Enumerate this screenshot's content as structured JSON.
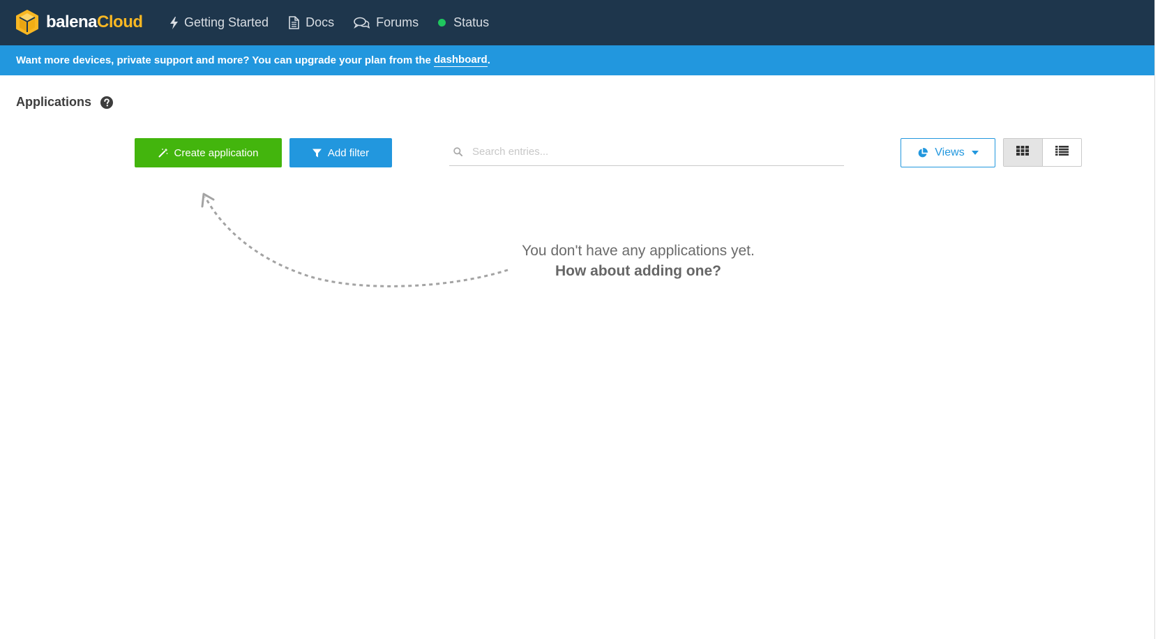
{
  "brand": {
    "part1": "balena",
    "part2": "Cloud"
  },
  "nav": {
    "getting_started": "Getting Started",
    "docs": "Docs",
    "forums": "Forums",
    "status": "Status"
  },
  "banner": {
    "text": "Want more devices, private support and more? You can upgrade your plan from the ",
    "link": "dashboard",
    "suffix": "."
  },
  "page": {
    "title": "Applications"
  },
  "toolbar": {
    "create_label": "Create application",
    "filter_label": "Add filter",
    "search_placeholder": "Search entries...",
    "views_label": "Views"
  },
  "empty_state": {
    "line1": "You don't have any applications yet.",
    "line2": "How about adding one?"
  },
  "colors": {
    "nav_bg": "#1e364c",
    "banner_bg": "#2297de",
    "brand_accent": "#f8b723",
    "create_green": "#43b50d",
    "status_green": "#1fc65e"
  },
  "icons": {
    "logo": "balena-cube-logo",
    "getting_started": "lightning-bolt-icon",
    "docs": "document-icon",
    "forums": "chat-bubbles-icon",
    "status": "status-dot",
    "help": "question-circle-icon",
    "create": "magic-wand-icon",
    "filter": "funnel-icon",
    "search": "search-icon",
    "views": "pie-chart-icon",
    "grid": "grid-view-icon",
    "list": "list-view-icon"
  }
}
